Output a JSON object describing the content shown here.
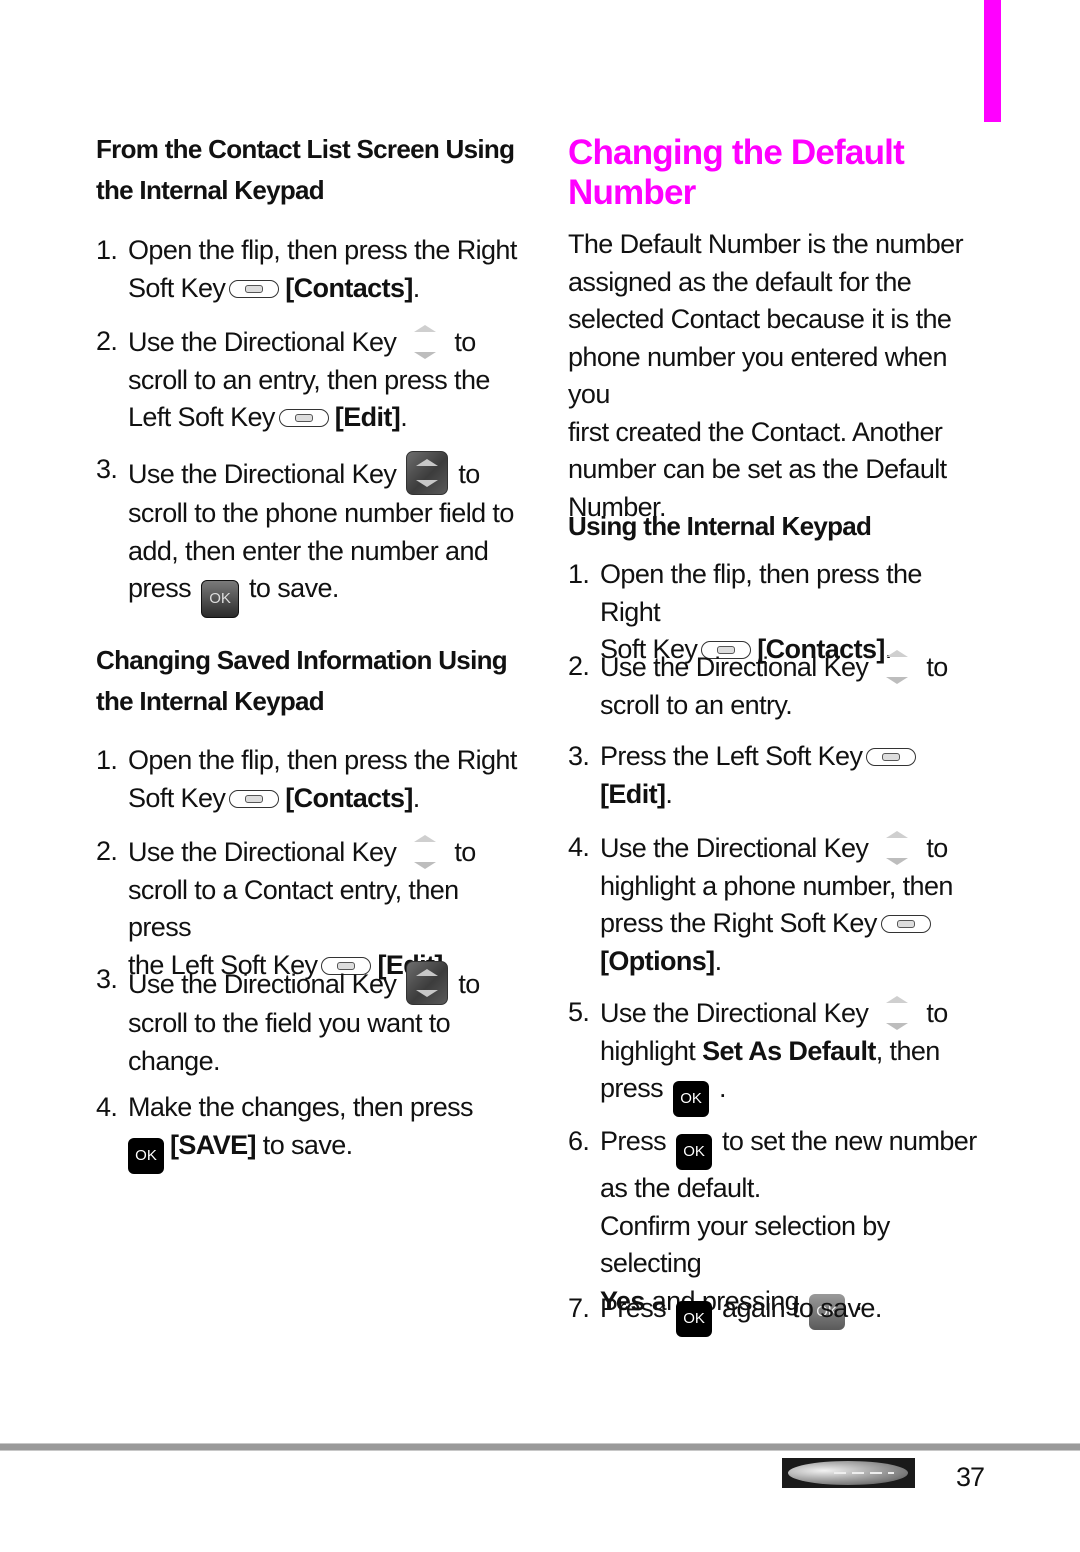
{
  "accent_color": "#ff00ff",
  "left_column": {
    "section1": {
      "heading_line1": "From the Contact List Screen Using",
      "heading_line2": "the Internal Keypad",
      "steps": [
        {
          "num": "1.",
          "l1": "Open the flip, then press the Right",
          "l2a": "Soft Key",
          "l2b": "[Contacts]",
          "l2c": "."
        },
        {
          "num": "2.",
          "l1a": "Use the Directional Key",
          "l1b": "to",
          "l2": "scroll to an entry, then press the",
          "l3a": "Left Soft Key",
          "l3b": "[Edit]",
          "l3c": "."
        },
        {
          "num": "3.",
          "l1a": "Use the Directional Key",
          "l1b": "to",
          "l2": "scroll to the phone number field to",
          "l3": "add, then enter the number and",
          "l4a": "press",
          "l4b": "to save."
        }
      ]
    },
    "section2": {
      "heading_line1": "Changing Saved Information Using",
      "heading_line2": "the Internal Keypad",
      "steps": [
        {
          "num": "1.",
          "l1": "Open the flip, then press the Right",
          "l2a": "Soft Key",
          "l2b": "[Contacts]",
          "l2c": "."
        },
        {
          "num": "2.",
          "l1a": "Use the Directional Key",
          "l1b": "to",
          "l2": "scroll to a Contact entry, then press",
          "l3a": "the Left Soft Key",
          "l3b": "[Edit]",
          "l3c": "."
        },
        {
          "num": "3.",
          "l1a": "Use the Directional Key",
          "l1b": "to",
          "l2": "scroll to the field you want to",
          "l3": "change."
        },
        {
          "num": "4.",
          "l1": "Make the changes, then press",
          "l2b": "[SAVE]",
          "l2c": " to save."
        }
      ]
    }
  },
  "right_column": {
    "title_line1": "Changing the Default",
    "title_line2": "Number",
    "intro": [
      "The Default Number is the number",
      "assigned as the default for the",
      "selected Contact because it is the",
      "phone number you entered when you",
      "first created the Contact. Another",
      "number can be set as the Default",
      "Number."
    ],
    "subheading": "Using the Internal Keypad",
    "steps": [
      {
        "num": "1.",
        "l1": "Open the flip, then press the Right",
        "l2a": "Soft Key",
        "l2b": "[Contacts]",
        "l2c": "."
      },
      {
        "num": "2.",
        "l1a": "Use the Directional Key",
        "l1b": "to",
        "l2": "scroll to an entry."
      },
      {
        "num": "3.",
        "l1a": "Press the Left Soft Key",
        "l2b": "[Edit]",
        "l2c": "."
      },
      {
        "num": "4.",
        "l1a": "Use the Directional Key",
        "l1b": "to",
        "l2": "highlight a phone number, then",
        "l3a": "press the Right Soft Key",
        "l4b": "[Options]",
        "l4c": "."
      },
      {
        "num": "5.",
        "l1a": "Use the Directional Key",
        "l1b": "to",
        "l2a": "highlight ",
        "l2b": "Set As Default",
        "l2c": ", then",
        "l3a": "press",
        "l3c": "."
      },
      {
        "num": "6.",
        "l1a": "Press",
        "l1b": "to set the new number",
        "l2": "as the default.",
        "l3": "Confirm your selection by selecting",
        "l4b": "Yes",
        "l4a": " and pressing",
        "l4c": "."
      },
      {
        "num": "7.",
        "l1a": "Press",
        "l1b": "again to save."
      }
    ]
  },
  "icons": {
    "ok_label": "OK"
  },
  "footer": {
    "page_number": "37"
  }
}
